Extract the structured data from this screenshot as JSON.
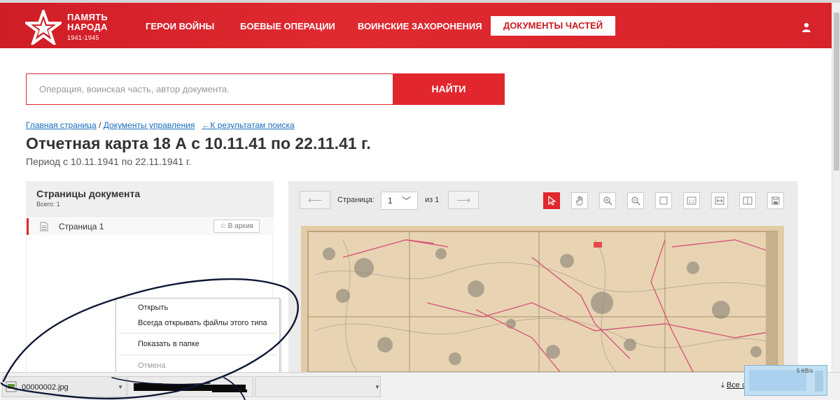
{
  "header": {
    "logo_line1": "ПАМЯТЬ",
    "logo_line2": "НАРОДА",
    "logo_years": "1941-1945",
    "nav": [
      "ГЕРОИ ВОЙНЫ",
      "БОЕВЫЕ ОПЕРАЦИИ",
      "ВОИНСКИЕ ЗАХОРОНЕНИЯ"
    ],
    "nav_active": "ДОКУМЕНТЫ ЧАСТЕЙ",
    "brand_color": "#e1262e"
  },
  "search": {
    "placeholder": "Операция, воинская часть, автор документа.",
    "button": "НАЙТИ"
  },
  "breadcrumb": {
    "home": "Главная страница",
    "sep": " / ",
    "section": "Документы управления",
    "back": "←К результатам поиска"
  },
  "document": {
    "title": "Отчетная карта 18 А с 10.11.41 по 22.11.41 г.",
    "period": "Период с 10.11.1941 по 22.11.1941 г."
  },
  "pages_panel": {
    "title": "Страницы документа",
    "total": "Всего: 1",
    "items": [
      {
        "label": "Страница 1",
        "archive": "☆ В архив"
      }
    ]
  },
  "viewer": {
    "prev": "⟵",
    "next": "⟶",
    "page_label": "Страница:",
    "page_value": "1",
    "of_label": "из 1",
    "tools": [
      "select-tool",
      "pan-tool",
      "zoom-in",
      "zoom-out",
      "fit-page",
      "actual-size",
      "fit-width",
      "fit-height",
      "save"
    ]
  },
  "context_menu": {
    "open": "Открыть",
    "always_open": "Всегда открывать файлы этого типа",
    "show_in_folder": "Показать в папке",
    "cancel": "Отмена"
  },
  "downloads": {
    "file": "00000002.jpg",
    "all": "Все скачанные файлы...",
    "speed": "5 KB/s"
  }
}
